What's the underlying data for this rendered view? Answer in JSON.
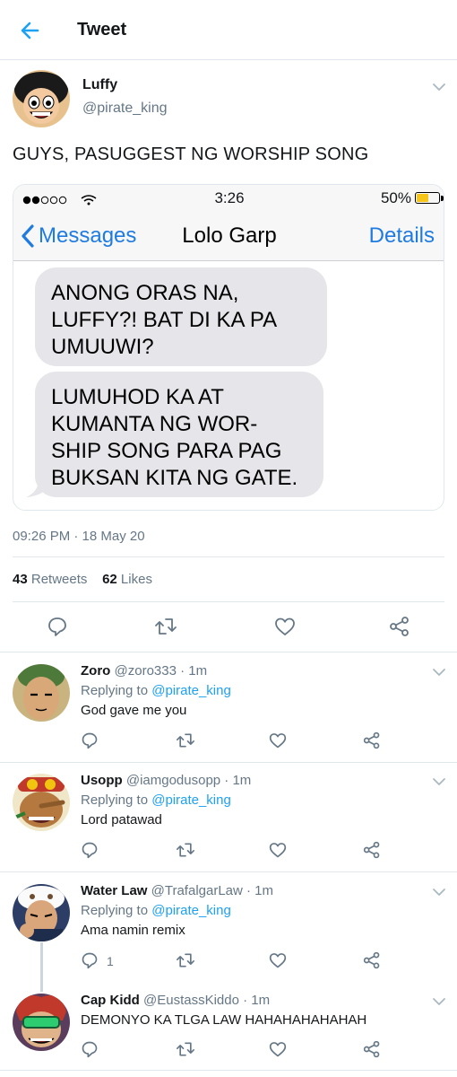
{
  "header": {
    "title": "Tweet"
  },
  "tweet": {
    "name": "Luffy",
    "handle": "@pirate_king",
    "text": "GUYS, PASUGGEST NG WORSHIP SONG",
    "timestamp": "09:26 PM · 18 May 20",
    "retweets": "43",
    "retweets_label": "Retweets",
    "likes": "62",
    "likes_label": "Likes"
  },
  "screenshot": {
    "time": "3:26",
    "battery": "50%",
    "battery_level": 0.5,
    "back_label": "Messages",
    "contact": "Lolo Garp",
    "details_label": "Details",
    "messages": [
      "ANONG ORAS NA, LUFFY?! BAT DI KA PA UMUUWI?",
      "LUMUHOD KA AT KUMANTA NG WOR- SHIP SONG PARA PAG BUKSAN KITA NG GATE."
    ]
  },
  "replies": [
    {
      "name": "Zoro",
      "meta": "@zoro333 · 1m",
      "replying_prefix": "Replying to",
      "mention": "@pirate_king",
      "text": "God gave me you",
      "reply_count": ""
    },
    {
      "name": "Usopp",
      "meta": "@iamgodusopp · 1m",
      "replying_prefix": "Replying to",
      "mention": "@pirate_king",
      "text": "Lord patawad",
      "reply_count": ""
    },
    {
      "name": "Water Law",
      "meta": "@TrafalgarLaw · 1m",
      "replying_prefix": "Replying to",
      "mention": "@pirate_king",
      "text": "Ama namin remix",
      "reply_count": "1"
    },
    {
      "name": "Cap Kidd",
      "meta": "@EustassKiddo · 1m",
      "text": "DEMONYO KA TLGA LAW HAHAHAHAHAHAH",
      "reply_count": ""
    }
  ],
  "colors": {
    "accent": "#1da1f2",
    "ios_blue": "#1e7be0",
    "bubble": "#e5e5ea",
    "secondary_text": "#657786"
  }
}
